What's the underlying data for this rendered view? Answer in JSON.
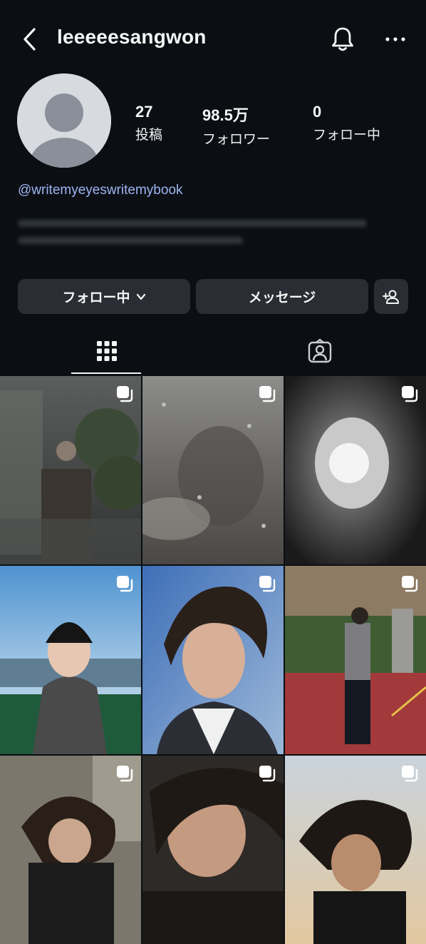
{
  "header": {
    "username": "leeeeesangwon",
    "icons": [
      "back-icon",
      "bell-icon",
      "more-icon"
    ]
  },
  "profile": {
    "stats": [
      {
        "value": "27",
        "label": "投稿"
      },
      {
        "value": "98.5万",
        "label": "フォロワー"
      },
      {
        "value": "0",
        "label": "フォロー中"
      }
    ],
    "link": "@writemyeyeswritemybook"
  },
  "actions": {
    "follow_label": "フォロー中",
    "message_label": "メッセージ"
  },
  "tabs": [
    "grid-icon",
    "tagged-icon"
  ],
  "grid": {
    "posts": [
      {
        "name": "post-1",
        "icon": "multiple-photos-icon"
      },
      {
        "name": "post-2",
        "icon": "multiple-photos-icon"
      },
      {
        "name": "post-3",
        "icon": "multiple-photos-icon"
      },
      {
        "name": "post-4",
        "icon": "multiple-photos-icon"
      },
      {
        "name": "post-5",
        "icon": "multiple-photos-icon"
      },
      {
        "name": "post-6",
        "icon": "multiple-photos-icon"
      },
      {
        "name": "post-7",
        "icon": "multiple-photos-icon"
      },
      {
        "name": "post-8",
        "icon": "multiple-photos-icon"
      },
      {
        "name": "post-9",
        "icon": "multiple-photos-icon"
      }
    ]
  },
  "colors": {
    "background": "#0b0f14",
    "button": "#2a2d33",
    "link": "#9fb4f2"
  }
}
